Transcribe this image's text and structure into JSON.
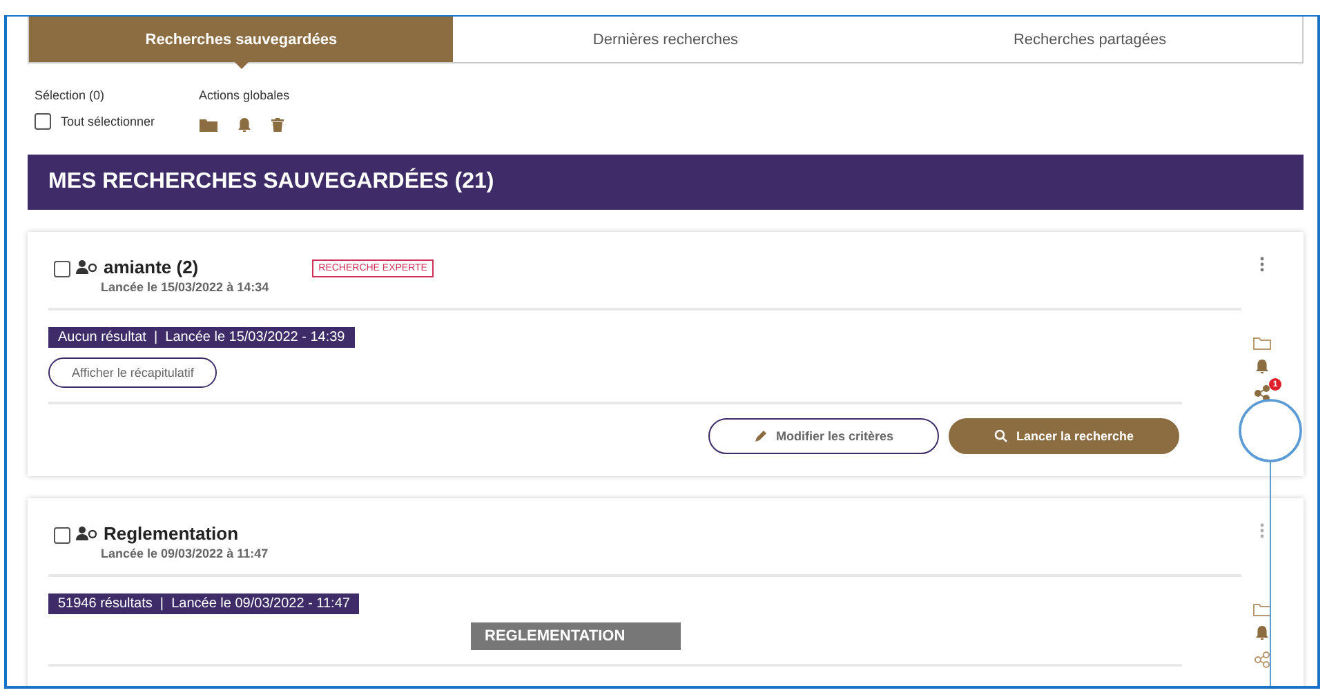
{
  "tabs": [
    {
      "label": "Recherches sauvegardées",
      "selected": true
    },
    {
      "label": "Dernières recherches",
      "selected": false
    },
    {
      "label": "Recherches partagées",
      "selected": false
    }
  ],
  "selection": {
    "label": "Sélection (0)",
    "select_all": {
      "label": "Tout sélectionner",
      "checked": false
    }
  },
  "global_actions": {
    "label": "Actions globales"
  },
  "header": {
    "title": "MES RECHERCHES SAUVEGARDÉES (21)"
  },
  "searches": [
    {
      "name": "amiante (2)",
      "checked": false,
      "badge": "RECHERCHE EXPERTE",
      "launched": "Lancée le 15/03/2022 à 14:34",
      "results": "Aucun résultat  |  Lancée le 15/03/2022 - 14:39",
      "summary_button": "Afficher le récapitulatif",
      "share_badge": "1",
      "buttons": [
        {
          "label": "Modifier les critères",
          "kind": "outline"
        },
        {
          "label": "Lancer la recherche",
          "kind": "primary"
        }
      ]
    },
    {
      "name": "Reglementation",
      "checked": false,
      "launched": "Lancée le 09/03/2022 à 11:47",
      "results": "51946 résultats  |  Lancée le 09/03/2022 - 11:47",
      "keyword": "REGLEMENTATION"
    }
  ]
}
